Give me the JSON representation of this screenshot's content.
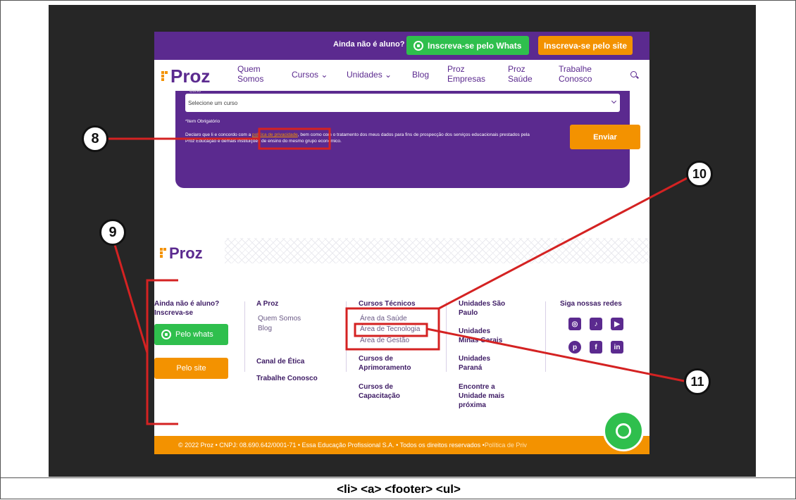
{
  "topbar": {
    "question": "Ainda não é aluno?",
    "whats_button": "Inscreva-se pelo Whats",
    "site_button": "Inscreva-se pelo site"
  },
  "nav": {
    "logo": "Proz",
    "items": [
      {
        "label": "Quem Somos"
      },
      {
        "label": "Cursos"
      },
      {
        "label": "Unidades"
      },
      {
        "label": "Blog"
      },
      {
        "label": "Proz Empresas"
      },
      {
        "label": "Proz Saúde"
      },
      {
        "label": "Trabalhe Conosco"
      }
    ]
  },
  "form": {
    "curso_label": "Curso",
    "select_value": "Selecione um curso",
    "required_note": "*Item Obrigatório",
    "consent_prefix": "Declaro que li e concordo com a",
    "consent_link": "política de privacidade",
    "consent_middle": ", bem como com o tratamento dos meus dados para fins de prospecção dos serviços educacionais prestados pela Proz Educação e demais instituições de ensino do mesmo grupo econômico.",
    "submit": "Enviar"
  },
  "footer": {
    "logo": "Proz",
    "cta_question": "Ainda não é aluno? Inscreva-se",
    "whats_button": "Pelo whats",
    "site_button": "Pelo site",
    "col_aproz": {
      "title": "A Proz",
      "links": [
        "Quem Somos",
        "Blog"
      ],
      "etica": "Canal de Ética",
      "trabalhe": "Trabalhe Conosco"
    },
    "col_cursos": {
      "title": "Cursos Técnicos",
      "links": [
        "Área da Saúde",
        "Área de Tecnologia",
        "Área de Gestão"
      ],
      "aprimoramento": "Cursos de Aprimoramento",
      "capacitacao": "Cursos de Capacitação"
    },
    "col_unidades": {
      "sp": "Unidades São Paulo",
      "mg": "Unidades Minas Gerais",
      "pr": "Unidades Paraná",
      "encontre": "Encontre a Unidade mais próxima"
    },
    "social": {
      "title": "Siga nossas redes",
      "icons": [
        "instagram-icon",
        "tiktok-icon",
        "youtube-icon",
        "pinterest-icon",
        "facebook-icon",
        "linkedin-icon"
      ]
    },
    "copyright": "© 2022 Proz • CNPJ: 08.690.642/0001-71 • Essa Educação Profissional S.A. • Todos os direitos reservados • ",
    "privacy": "Política de Priv"
  },
  "annotations": {
    "n8": "8",
    "n9": "9",
    "n10": "10",
    "n11": "11",
    "color": "#d42222"
  },
  "caption": "<li> <a> <footer> <ul>",
  "colors": {
    "purple": "#5b2a8f",
    "orange": "#f39200",
    "green": "#2fbf4d"
  }
}
